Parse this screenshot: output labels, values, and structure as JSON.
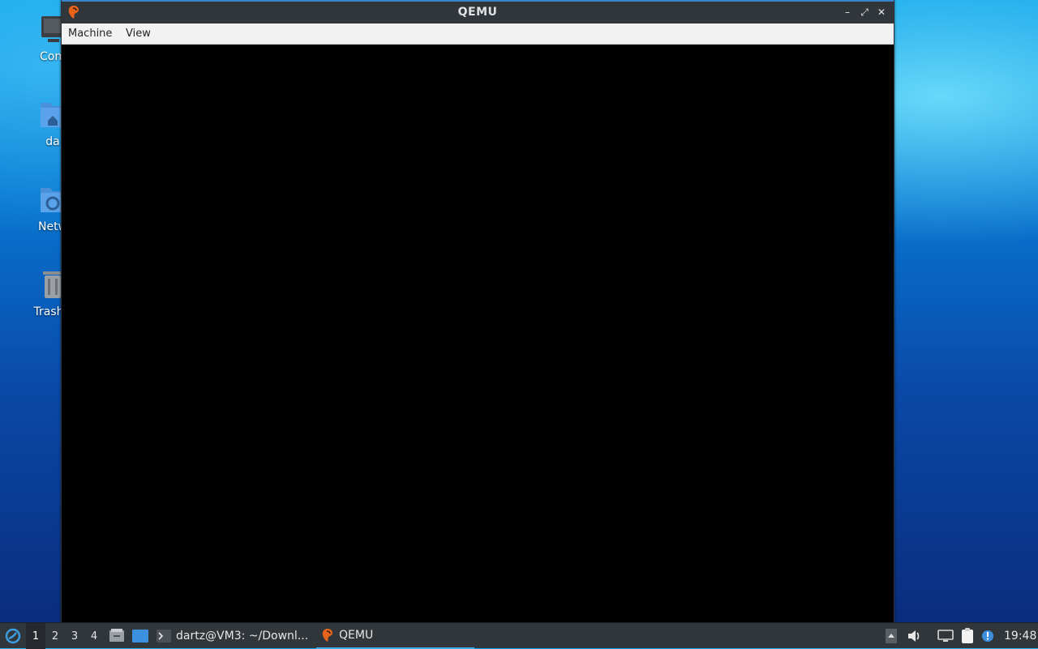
{
  "desktop": {
    "icons": [
      {
        "label": "Com",
        "icon": "computer-icon"
      },
      {
        "label": "da",
        "icon": "home-folder-icon"
      },
      {
        "label": "Netw",
        "icon": "network-folder-icon"
      },
      {
        "label": "Trash (",
        "icon": "trash-icon"
      }
    ]
  },
  "window": {
    "title": "QEMU",
    "controls": {
      "minimize": "–",
      "maximize": "⤢",
      "close": "✕"
    },
    "menu": [
      "Machine",
      "View"
    ]
  },
  "taskbar": {
    "desktops": [
      "1",
      "2",
      "3",
      "4"
    ],
    "active_desktop": "1",
    "tasks": [
      {
        "label": "dartz@VM3: ~/Downl...",
        "icon": "terminal-icon"
      },
      {
        "label": "QEMU",
        "icon": "qemu-icon"
      }
    ],
    "clock": "19:48"
  }
}
